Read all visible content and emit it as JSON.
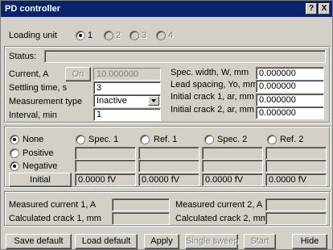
{
  "window": {
    "title": "PD controller",
    "help_label": "?",
    "close_label": "X"
  },
  "loading": {
    "label": "Loading unit",
    "options": [
      {
        "label": "1",
        "selected": true,
        "enabled": true
      },
      {
        "label": "2",
        "selected": false,
        "enabled": false
      },
      {
        "label": "3",
        "selected": false,
        "enabled": false
      },
      {
        "label": "4",
        "selected": false,
        "enabled": false
      }
    ]
  },
  "status": {
    "label": "Status:",
    "value": ""
  },
  "current": {
    "label": "Current, A",
    "on_label": "On",
    "value": "10.000000"
  },
  "settling": {
    "label": "Settling time, s",
    "value": "3"
  },
  "measurement": {
    "label": "Measurement type",
    "value": "Inactive"
  },
  "interval": {
    "label": "Interval, min",
    "value": "1"
  },
  "spec_width": {
    "label": "Spec. width, W, mm",
    "value": "0.000000"
  },
  "lead_spacing": {
    "label": "Lead spacing, Yo, mm",
    "value": "0.000000"
  },
  "crack1": {
    "label": "Initial crack 1, ar, mm",
    "value": "0.000000"
  },
  "crack2": {
    "label": "Initial crack 2, ar, mm",
    "value": "0.000000"
  },
  "channels": {
    "none_label": "None",
    "spec1_label": "Spec. 1",
    "ref1_label": "Ref. 1",
    "spec2_label": "Spec. 2",
    "ref2_label": "Ref. 2",
    "positive_label": "Positive",
    "negative_label": "Negative",
    "initial_label": "Initial",
    "initial_values": [
      "0.0000 fV",
      "0.0000 fV",
      "0.0000 fV",
      "0.0000 fV"
    ]
  },
  "results": {
    "meas1_label": "Measured current 1, A",
    "meas2_label": "Measured current 2, A",
    "calc1_label": "Calculated crack 1, mm",
    "calc2_label": "Calculated crack 2, mm"
  },
  "buttons": {
    "save_default": "Save default",
    "load_default": "Load default",
    "apply": "Apply",
    "single_sweep": "Single sweep",
    "start": "Start",
    "hide": "Hide"
  }
}
